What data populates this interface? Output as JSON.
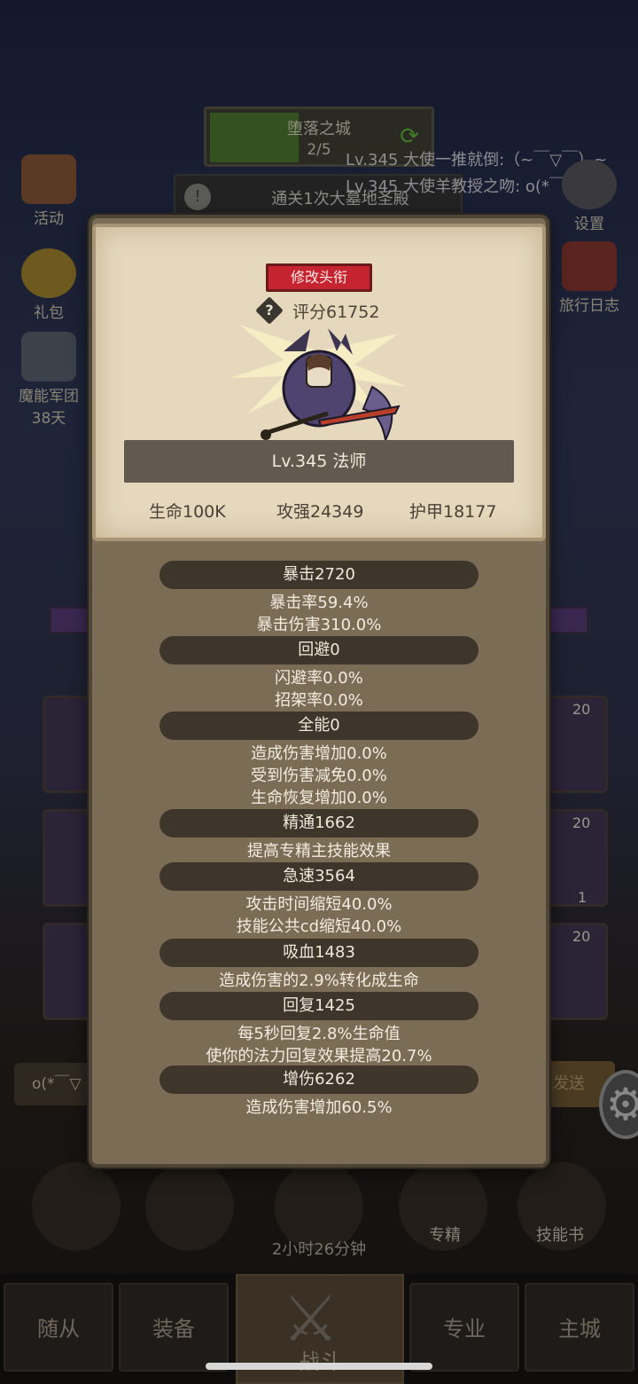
{
  "background": {
    "stage_name": "堕落之城",
    "stage_progress": "2/5",
    "quest_text": "通关1次大墓地圣殿",
    "chat_lines": [
      "Lv.345 大使一推就倒:（~￣▽￣）~",
      "Lv.345 大使羊教授之吻: o(*￣"
    ],
    "side_left": [
      {
        "label": "活动"
      },
      {
        "label": "礼包"
      },
      {
        "label": "魔能军团",
        "sub": "38天"
      }
    ],
    "side_right": [
      {
        "label": "设置"
      },
      {
        "label": "旅行日志"
      }
    ],
    "slot_numbers": [
      "20",
      "20",
      "1",
      "20"
    ],
    "chat_input_text": "o(*￣▽",
    "send_text": "发送",
    "bottom_labels": [
      "专精",
      "技能书"
    ],
    "timer": "2小时26分钟",
    "nav_tabs": [
      "随从",
      "装备",
      "战斗",
      "专业",
      "主城"
    ]
  },
  "panel": {
    "title_button": "修改头衔",
    "score": "评分61752",
    "level_class": "Lv.345 法师",
    "base_stats": [
      "生命100K",
      "攻强24349",
      "护甲18177"
    ],
    "sections": [
      {
        "header": "暴击2720",
        "lines": [
          "暴击率59.4%",
          "暴击伤害310.0%"
        ]
      },
      {
        "header": "回避0",
        "lines": [
          "闪避率0.0%",
          "招架率0.0%"
        ]
      },
      {
        "header": "全能0",
        "lines": [
          "造成伤害增加0.0%",
          "受到伤害减免0.0%",
          "生命恢复增加0.0%"
        ]
      },
      {
        "header": "精通1662",
        "lines": [
          "提高专精主技能效果"
        ]
      },
      {
        "header": "急速3564",
        "lines": [
          "攻击时间缩短40.0%",
          "技能公共cd缩短40.0%"
        ]
      },
      {
        "header": "吸血1483",
        "lines": [
          "造成伤害的2.9%转化成生命"
        ]
      },
      {
        "header": "回复1425",
        "lines": [
          "每5秒回复2.8%生命值",
          "使你的法力回复效果提高20.7%"
        ]
      },
      {
        "header": "增伤6262",
        "lines": [
          "造成伤害增加60.5%"
        ]
      }
    ]
  },
  "colors": {
    "panel_bg": "#7b6c56",
    "parchment": "#e5d8bd",
    "header_pill": "#3f362b",
    "title_red": "#c4232f"
  }
}
